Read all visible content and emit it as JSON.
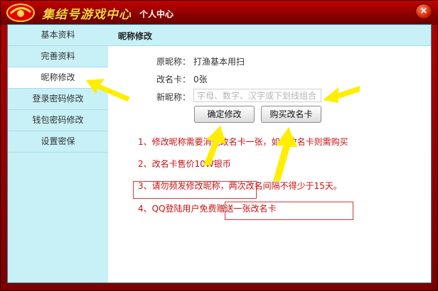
{
  "titlebar": {
    "app_title": "集结号游戏中心",
    "sub_title": "个人中心",
    "close_label": "×"
  },
  "sidebar": {
    "items": [
      {
        "label": "基本资料"
      },
      {
        "label": "完善资料"
      },
      {
        "label": "昵称修改",
        "active": true
      },
      {
        "label": "登录密码修改"
      },
      {
        "label": "钱包密码修改"
      },
      {
        "label": "设置密保"
      }
    ]
  },
  "main": {
    "section_title": "昵称修改",
    "old_nick_label": "原昵称：",
    "old_nick_value": "打渔基本用扫",
    "rename_card_label": "改名卡：",
    "rename_card_value": "0张",
    "new_nick_label": "新昵称：",
    "new_nick_placeholder": "字母、数字、汉字或下划线组合",
    "confirm_button": "确定修改",
    "buy_card_button": "购买改名卡",
    "notes": [
      "1、修改昵称需要消耗改名卡一张，如无改名卡则需购买",
      "2、改名卡售价10W银币",
      "3、请勿频发修改昵称，两次改名间隔不得少于15天。",
      "4、QQ登陆用户免费赠送一张改名卡"
    ]
  },
  "colors": {
    "title_red": "#b40000",
    "title_text": "#ffd23f",
    "sidebar_bg": "#c7f0f7",
    "note_red": "#c41212",
    "arrow_yellow": "#ffee00"
  }
}
